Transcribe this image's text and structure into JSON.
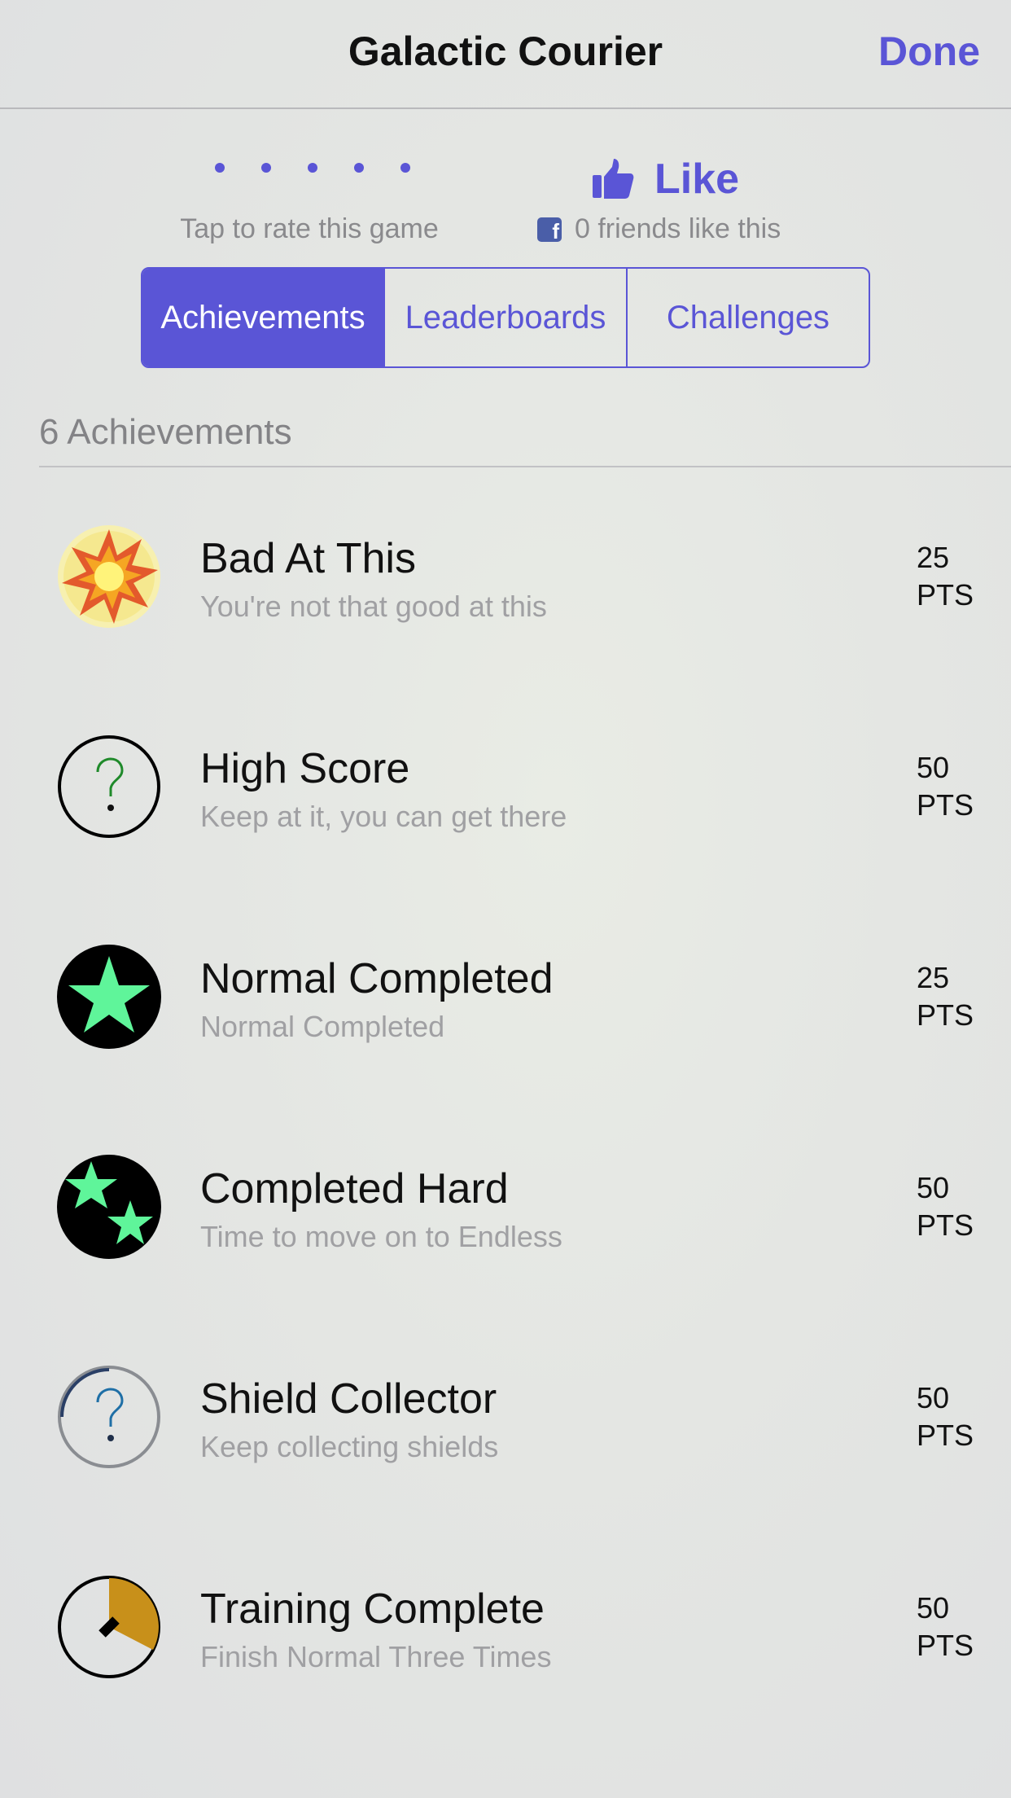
{
  "nav": {
    "title": "Galactic Courier",
    "done_label": "Done"
  },
  "rating": {
    "label": "Tap to rate this game"
  },
  "like": {
    "label": "Like",
    "friends_text": "0 friends like this",
    "fb_glyph": "f"
  },
  "tabs": [
    {
      "label": "Achievements",
      "active": true
    },
    {
      "label": "Leaderboards",
      "active": false
    },
    {
      "label": "Challenges",
      "active": false
    }
  ],
  "section": {
    "header": "6 Achievements"
  },
  "achievements": [
    {
      "title": "Bad At This",
      "subtitle": "You're not that good at this",
      "points": "25",
      "unit": "PTS",
      "icon": "explosion-icon"
    },
    {
      "title": "High Score",
      "subtitle": "Keep at it, you can get there",
      "points": "50",
      "unit": "PTS",
      "icon": "question-mark-icon"
    },
    {
      "title": "Normal Completed",
      "subtitle": "Normal Completed",
      "points": "25",
      "unit": "PTS",
      "icon": "star-icon"
    },
    {
      "title": "Completed Hard",
      "subtitle": "Time to move on to Endless",
      "points": "50",
      "unit": "PTS",
      "icon": "two-stars-icon"
    },
    {
      "title": "Shield Collector",
      "subtitle": "Keep collecting shields",
      "points": "50",
      "unit": "PTS",
      "icon": "question-mark-icon"
    },
    {
      "title": "Training Complete",
      "subtitle": "Finish Normal Three Times",
      "points": "50",
      "unit": "PTS",
      "icon": "progress-pie-icon"
    }
  ],
  "colors": {
    "accent": "#5a55d6",
    "star_green": "#5ff59a",
    "gold": "#c8901a"
  }
}
